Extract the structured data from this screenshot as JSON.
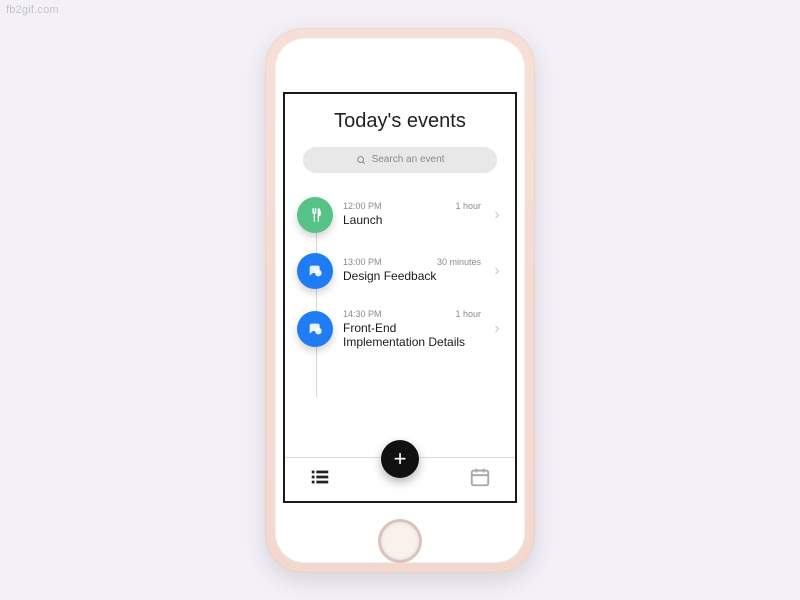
{
  "watermark": "fb2gif.com",
  "header": {
    "title": "Today's events"
  },
  "search": {
    "placeholder": "Search an event"
  },
  "events": [
    {
      "time": "12:00 PM",
      "duration": "1 hour",
      "title": "Launch",
      "icon": "fork-knife-icon",
      "color": "green"
    },
    {
      "time": "13:00 PM",
      "duration": "30 minutes",
      "title": "Design Feedback",
      "icon": "chat-icon",
      "color": "blue"
    },
    {
      "time": "14:30 PM",
      "duration": "1 hour",
      "title": "Front-End Implementation Details",
      "icon": "chat-icon",
      "color": "blue"
    }
  ],
  "fab": {
    "label": "+"
  },
  "colors": {
    "green": "#56c288",
    "blue": "#1f7cf2",
    "fab": "#111111"
  }
}
